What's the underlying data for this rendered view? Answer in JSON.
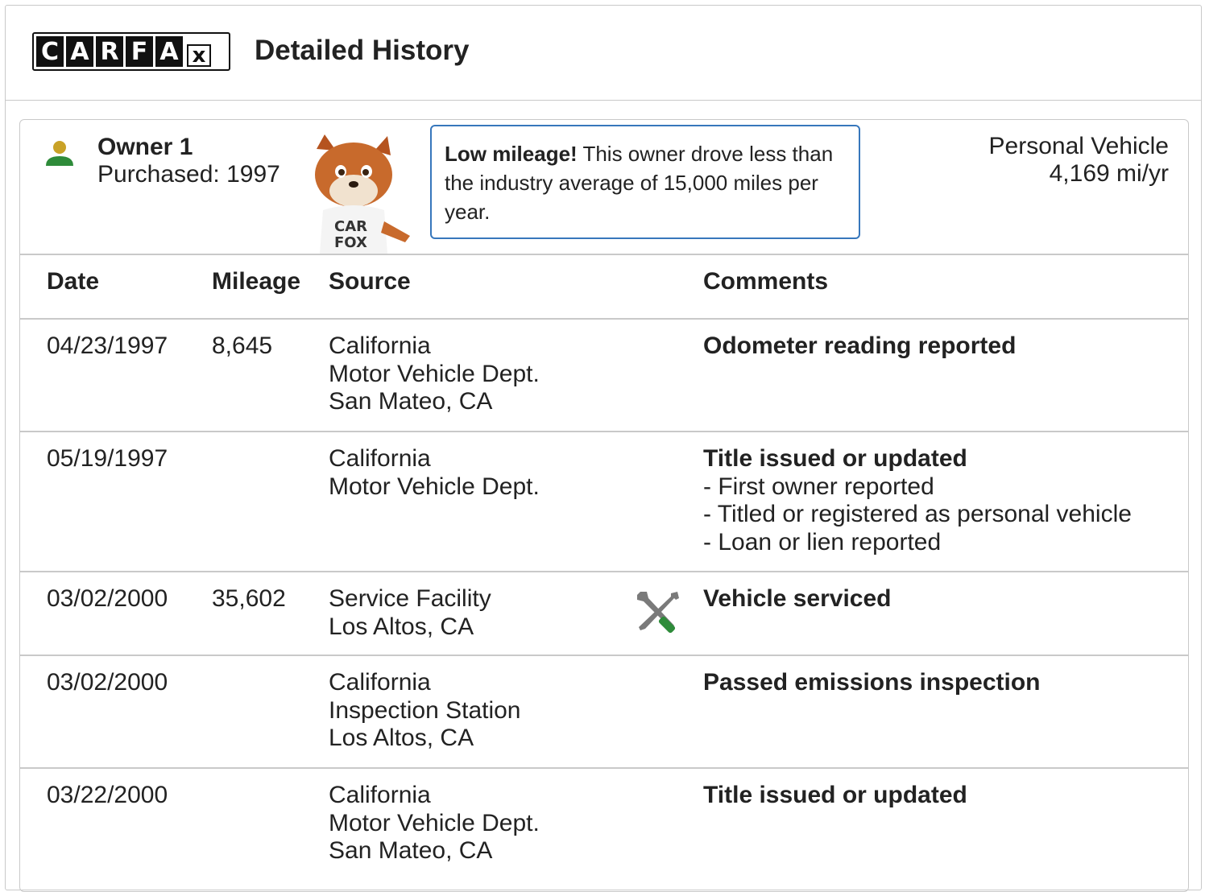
{
  "header": {
    "logo_letters": [
      "C",
      "A",
      "R",
      "F",
      "A",
      "x"
    ],
    "title": "Detailed History"
  },
  "owner": {
    "name": "Owner 1",
    "purchased": "Purchased: 1997",
    "callout_bold": "Low mileage!",
    "callout_text": " This owner drove less than the industry average of 15,000 miles per year.",
    "usage_type": "Personal Vehicle",
    "usage_miles": "4,169 mi/yr"
  },
  "table": {
    "headers": {
      "date": "Date",
      "mileage": "Mileage",
      "source": "Source",
      "comments": "Comments"
    },
    "rows": [
      {
        "date": "04/23/1997",
        "mileage": "8,645",
        "source": [
          "California",
          "Motor Vehicle Dept.",
          "San Mateo, CA"
        ],
        "comment_title": "Odometer reading reported",
        "comment_items": []
      },
      {
        "date": "05/19/1997",
        "mileage": "",
        "source": [
          "California",
          "Motor Vehicle Dept."
        ],
        "comment_title": "Title issued or updated",
        "comment_items": [
          "- First owner reported",
          "- Titled or registered as personal vehicle",
          "- Loan or lien reported"
        ]
      },
      {
        "date": "03/02/2000",
        "mileage": "35,602",
        "source": [
          "Service Facility",
          "Los Altos, CA"
        ],
        "comment_title": "Vehicle serviced",
        "comment_items": [],
        "icon": "wrench-screwdriver-icon"
      },
      {
        "date": "03/02/2000",
        "mileage": "",
        "source": [
          "California",
          "Inspection Station",
          "Los Altos, CA"
        ],
        "comment_title": "Passed emissions inspection",
        "comment_items": []
      },
      {
        "date": "03/22/2000",
        "mileage": "",
        "source": [
          "California",
          "Motor Vehicle Dept.",
          "San Mateo, CA"
        ],
        "comment_title": "Title issued or updated",
        "comment_items": []
      }
    ]
  },
  "colors": {
    "callout_border": "#3777bc",
    "owner_icon_head": "#c9a227",
    "owner_icon_body": "#2e8b3a",
    "divider": "#c9c9c9"
  }
}
